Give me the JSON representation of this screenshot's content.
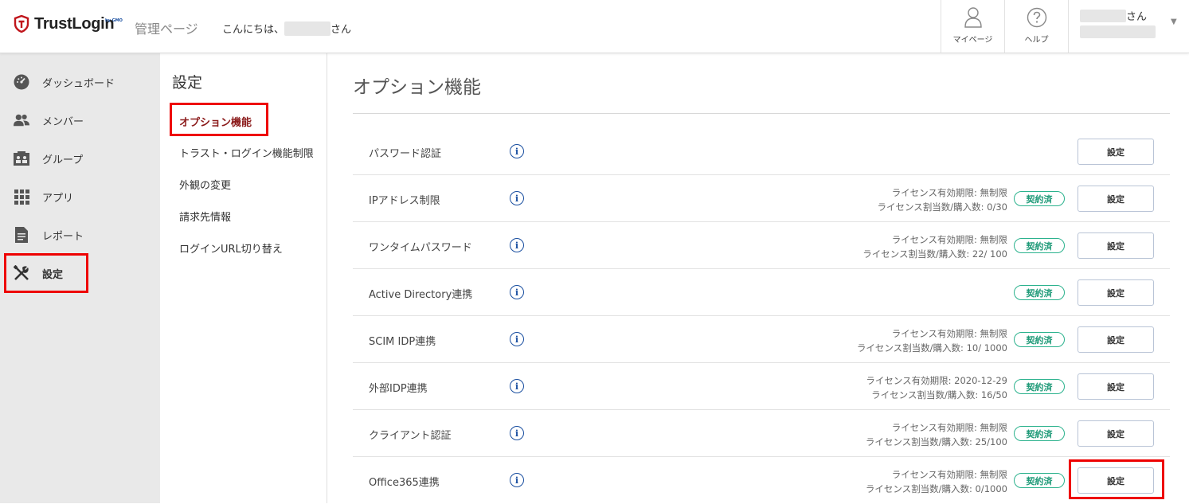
{
  "header": {
    "logo_text": "TrustLogin",
    "logo_sub": "by GMO",
    "admin_label": "管理ページ",
    "greeting_prefix": "こんにちは、",
    "greeting_suffix": "さん",
    "mypage_label": "マイページ",
    "help_label": "ヘルプ",
    "user_suffix": "さん",
    "caret": "▼"
  },
  "sidebar": {
    "items": [
      {
        "label": "ダッシュボード",
        "icon": "gauge-icon"
      },
      {
        "label": "メンバー",
        "icon": "users-icon"
      },
      {
        "label": "グループ",
        "icon": "group-icon"
      },
      {
        "label": "アプリ",
        "icon": "grid-icon"
      },
      {
        "label": "レポート",
        "icon": "document-icon"
      },
      {
        "label": "設定",
        "icon": "tools-icon"
      }
    ]
  },
  "subnav": {
    "title": "設定",
    "items": [
      {
        "label": "オプション機能"
      },
      {
        "label": "トラスト・ログイン機能制限"
      },
      {
        "label": "外観の変更"
      },
      {
        "label": "請求先情報"
      },
      {
        "label": "ログインURL切り替え"
      }
    ]
  },
  "main": {
    "title": "オプション機能",
    "info_glyph": "i",
    "badge_label": "契約済",
    "button_label": "設定",
    "rows": [
      {
        "name": "パスワード認証",
        "lic1": "",
        "lic2": "",
        "badge": ""
      },
      {
        "name": "IPアドレス制限",
        "lic1": "ライセンス有効期限: 無制限",
        "lic2": "ライセンス割当数/購入数: 0/30",
        "badge": "契約済"
      },
      {
        "name": "ワンタイムパスワード",
        "lic1": "ライセンス有効期限: 無制限",
        "lic2": "ライセンス割当数/購入数: 22/ 100",
        "badge": "契約済"
      },
      {
        "name": "Active Directory連携",
        "lic1": "",
        "lic2": "",
        "badge": "契約済"
      },
      {
        "name": "SCIM IDP連携",
        "lic1": "ライセンス有効期限: 無制限",
        "lic2": "ライセンス割当数/購入数: 10/ 1000",
        "badge": "契約済"
      },
      {
        "name": "外部IDP連携",
        "lic1": "ライセンス有効期限: 2020-12-29",
        "lic2": "ライセンス割当数/購入数: 16/50",
        "badge": "契約済"
      },
      {
        "name": "クライアント認証",
        "lic1": "ライセンス有効期限: 無制限",
        "lic2": "ライセンス割当数/購入数: 25/100",
        "badge": "契約済"
      },
      {
        "name": "Office365連携",
        "lic1": "ライセンス有効期限: 無制限",
        "lic2": "ライセンス割当数/購入数: 0/1000",
        "badge": "契約済"
      }
    ]
  },
  "colors": {
    "accent_red": "#e00000",
    "badge_green": "#2bb28d",
    "info_blue": "#1a4fa0",
    "active_subnav": "#8b1a1a"
  }
}
